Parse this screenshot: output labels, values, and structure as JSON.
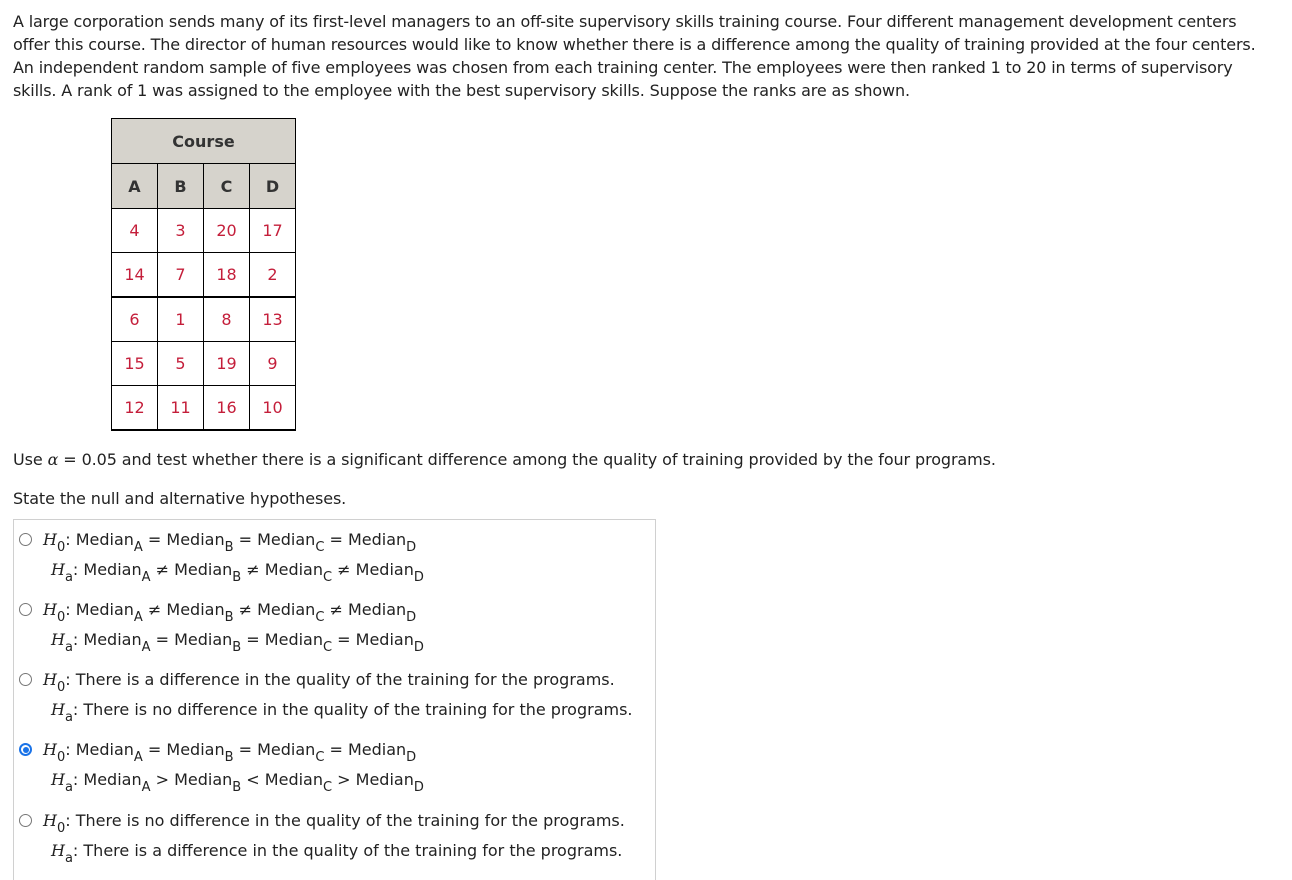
{
  "intro": "A large corporation sends many of its first-level managers to an off-site supervisory skills training course. Four different management development centers offer this course. The director of human resources would like to know whether there is a difference among the quality of training provided at the four centers. An independent random sample of five employees was chosen from each training center. The employees were then ranked 1 to 20 in terms of supervisory skills. A rank of 1 was assigned to the employee with the best supervisory skills. Suppose the ranks are as shown.",
  "table": {
    "title": "Course",
    "columns": [
      "A",
      "B",
      "C",
      "D"
    ],
    "rows": [
      [
        "4",
        "3",
        "20",
        "17"
      ],
      [
        "14",
        "7",
        "18",
        "2"
      ],
      [
        "6",
        "1",
        "8",
        "13"
      ],
      [
        "15",
        "5",
        "19",
        "9"
      ],
      [
        "12",
        "11",
        "16",
        "10"
      ]
    ]
  },
  "instruction": {
    "prefix": "Use ",
    "alpha_symbol": "α",
    "suffix": " = 0.05 and test whether there is a significant difference among the quality of training provided by the four programs."
  },
  "prompt": "State the null and alternative hypotheses.",
  "options": [
    {
      "selected": false,
      "h0": [
        {
          "t": "Median"
        },
        {
          "s": "A"
        },
        {
          "t": " = Median"
        },
        {
          "s": "B"
        },
        {
          "t": " = Median"
        },
        {
          "s": "C"
        },
        {
          "t": " = Median"
        },
        {
          "s": "D"
        }
      ],
      "ha": [
        {
          "t": "Median"
        },
        {
          "s": "A"
        },
        {
          "t": " ≠ Median"
        },
        {
          "s": "B"
        },
        {
          "t": " ≠ Median"
        },
        {
          "s": "C"
        },
        {
          "t": " ≠ Median"
        },
        {
          "s": "D"
        }
      ]
    },
    {
      "selected": false,
      "h0": [
        {
          "t": "Median"
        },
        {
          "s": "A"
        },
        {
          "t": " ≠ Median"
        },
        {
          "s": "B"
        },
        {
          "t": " ≠ Median"
        },
        {
          "s": "C"
        },
        {
          "t": " ≠ Median"
        },
        {
          "s": "D"
        }
      ],
      "ha": [
        {
          "t": "Median"
        },
        {
          "s": "A"
        },
        {
          "t": " = Median"
        },
        {
          "s": "B"
        },
        {
          "t": " = Median"
        },
        {
          "s": "C"
        },
        {
          "t": " = Median"
        },
        {
          "s": "D"
        }
      ]
    },
    {
      "selected": false,
      "h0": [
        {
          "t": "There is a difference in the quality of the training for the programs."
        }
      ],
      "ha": [
        {
          "t": "There is no difference in the quality of the training for the programs."
        }
      ]
    },
    {
      "selected": true,
      "h0": [
        {
          "t": "Median"
        },
        {
          "s": "A"
        },
        {
          "t": " = Median"
        },
        {
          "s": "B"
        },
        {
          "t": " = Median"
        },
        {
          "s": "C"
        },
        {
          "t": " = Median"
        },
        {
          "s": "D"
        }
      ],
      "ha": [
        {
          "t": "Median"
        },
        {
          "s": "A"
        },
        {
          "t": " > Median"
        },
        {
          "s": "B"
        },
        {
          "t": " < Median"
        },
        {
          "s": "C"
        },
        {
          "t": " > Median"
        },
        {
          "s": "D"
        }
      ]
    },
    {
      "selected": false,
      "h0": [
        {
          "t": "There is no difference in the quality of the training for the programs."
        }
      ],
      "ha": [
        {
          "t": "There is a difference in the quality of the training for the programs."
        }
      ]
    }
  ],
  "labels": {
    "H": "H",
    "h0_sub": "0",
    "ha_sub": "a",
    "colon": ": "
  },
  "colors": {
    "data_text": "#c41e3a",
    "header_bg": "#d6d3cc",
    "radio_selected": "#1a73e8"
  }
}
